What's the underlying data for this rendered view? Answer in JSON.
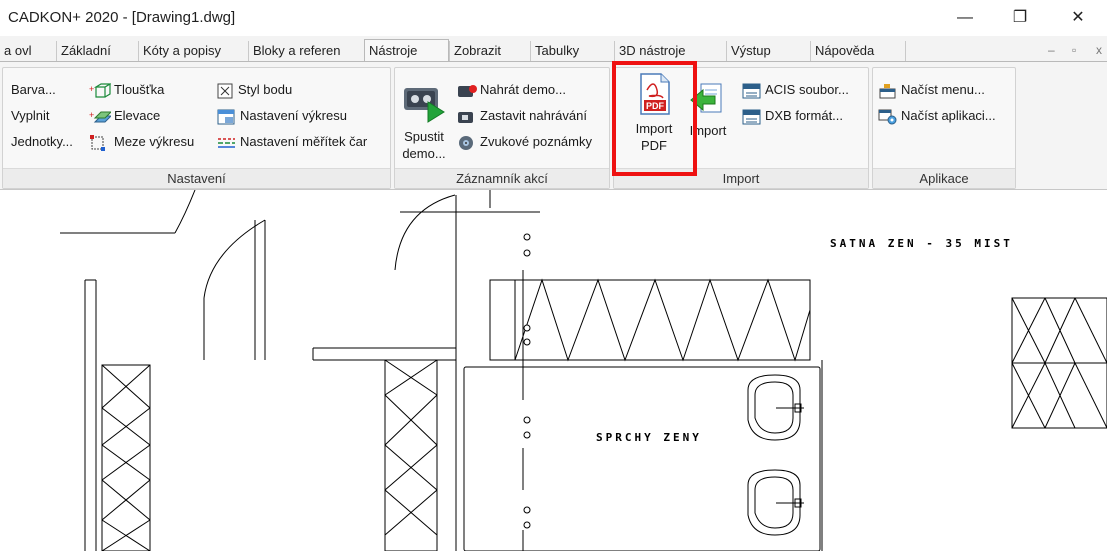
{
  "window": {
    "title": "CADKON+ 2020 - [Drawing1.dwg]",
    "minimize_glyph": "—",
    "restore_glyph": "❐",
    "close_glyph": "✕"
  },
  "tabs": [
    {
      "label": "a ovl"
    },
    {
      "label": "Základní"
    },
    {
      "label": "Kóty a popisy"
    },
    {
      "label": "Bloky a referen"
    },
    {
      "label": "Nástroje",
      "active": true
    },
    {
      "label": "Zobrazit"
    },
    {
      "label": "Tabulky"
    },
    {
      "label": "3D nástroje"
    },
    {
      "label": "Výstup"
    },
    {
      "label": "Nápověda"
    }
  ],
  "tab_controls": {
    "minimize": "–",
    "restore": "▫",
    "close": "x"
  },
  "groups": {
    "nastaveni": {
      "label": "Nastavení",
      "items": [
        "Barva...",
        "Vyplnit",
        "Jednotky...",
        "Tloušťka",
        "Elevace",
        "Meze výkresu",
        "Styl bodu",
        "Nastavení výkresu",
        "Nastavení měřítek čar"
      ]
    },
    "zaznamnik": {
      "label": "Záznamník akcí",
      "big_line1": "Spustit",
      "big_line2": "demo...",
      "items": [
        "Nahrát demo...",
        "Zastavit nahrávání",
        "Zvukové poznámky"
      ]
    },
    "import": {
      "label": "Import",
      "import_pdf_line1": "Import",
      "import_pdf_line2": "PDF",
      "import_label": "Import",
      "items": [
        "ACIS soubor...",
        "DXB formát..."
      ]
    },
    "aplikace": {
      "label": "Aplikace",
      "items": [
        "Načíst menu...",
        "Načíst aplikaci..."
      ]
    }
  },
  "colors": {
    "highlight_box": "#ee1111",
    "ribbon_bg": "#f4f4f4",
    "tab_bg": "#f3f3f3"
  },
  "drawing": {
    "label_satna": "SATNA ZEN - 35 MIST",
    "label_sprchy": "SPRCHY ZENY"
  }
}
